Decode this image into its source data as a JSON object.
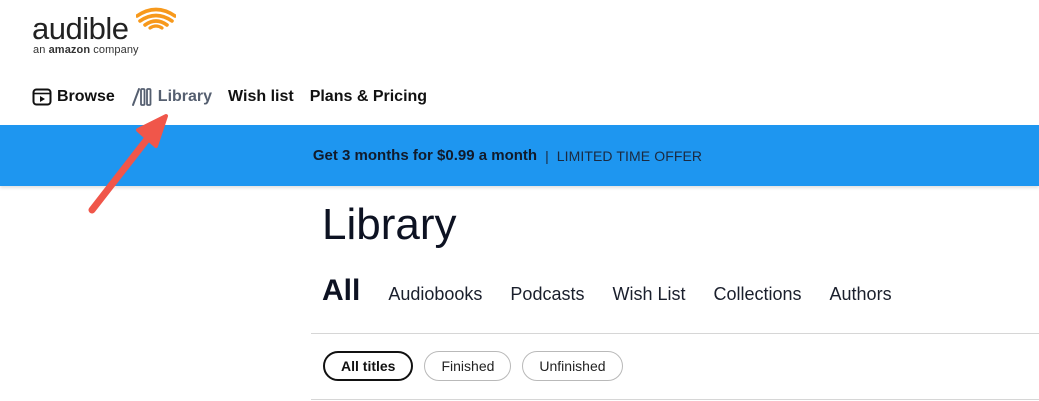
{
  "logo": {
    "word": "audible",
    "sub_prefix": "an ",
    "sub_brand": "amazon",
    "sub_suffix": " company",
    "accent_color": "#f7991c"
  },
  "nav": {
    "items": [
      {
        "label": "Browse",
        "icon": "play-box-icon",
        "active": false
      },
      {
        "label": "Library",
        "icon": "library-books-icon",
        "active": true
      },
      {
        "label": "Wish list",
        "active": false
      },
      {
        "label": "Plans & Pricing",
        "active": false
      }
    ]
  },
  "banner": {
    "main": "Get 3 months for $0.99 a month",
    "separator": "|",
    "sub": "LIMITED TIME OFFER",
    "bg_color": "#1e96f0"
  },
  "annotation": {
    "arrow_color": "#f0564a"
  },
  "library": {
    "title": "Library",
    "tabs": [
      {
        "label": "All",
        "active": true
      },
      {
        "label": "Audiobooks",
        "active": false
      },
      {
        "label": "Podcasts",
        "active": false
      },
      {
        "label": "Wish List",
        "active": false
      },
      {
        "label": "Collections",
        "active": false
      },
      {
        "label": "Authors",
        "active": false
      }
    ],
    "filters": [
      {
        "label": "All titles",
        "active": true
      },
      {
        "label": "Finished",
        "active": false
      },
      {
        "label": "Unfinished",
        "active": false
      }
    ]
  }
}
